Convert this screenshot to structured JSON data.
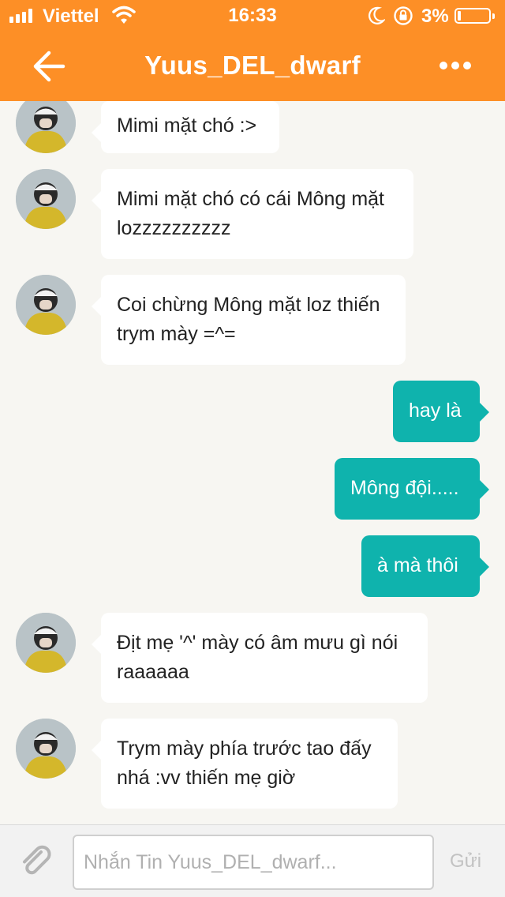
{
  "status_bar": {
    "carrier": "Viettel",
    "time": "16:33",
    "battery_percent": "3%",
    "battery_level": 0.03
  },
  "header": {
    "title": "Yuus_DEL_dwarf",
    "back_icon": "arrow-left-icon",
    "more_icon": "more-dots-icon",
    "color": "#fd8f26"
  },
  "messages": [
    {
      "side": "incoming",
      "text": "Mimi mặt chó :>"
    },
    {
      "side": "incoming",
      "lines": [
        "Mimi mặt chó có cái Mông mặt",
        "lozzzzzzzzzz"
      ]
    },
    {
      "side": "incoming",
      "lines": [
        "Coi chừng Mông mặt loz thiến",
        "trym mày =^="
      ]
    },
    {
      "side": "outgoing",
      "text": "hay là"
    },
    {
      "side": "outgoing",
      "text": "Mông đội....."
    },
    {
      "side": "outgoing",
      "text": "à mà thôi"
    },
    {
      "side": "incoming",
      "lines": [
        "Địt mẹ '^' mày có âm mưu gì nói",
        "raaaaaa"
      ]
    },
    {
      "side": "incoming",
      "lines": [
        "Trym mày phía trước tao đấy",
        "nhá :vv thiến mẹ giờ"
      ]
    }
  ],
  "composer": {
    "placeholder": "Nhắn Tin Yuus_DEL_dwarf...",
    "send_label": "Gửi",
    "attach_icon": "paperclip-icon"
  },
  "colors": {
    "outgoing_bubble": "#0fb3ad",
    "incoming_bubble": "#ffffff",
    "background": "#f7f6f2"
  }
}
